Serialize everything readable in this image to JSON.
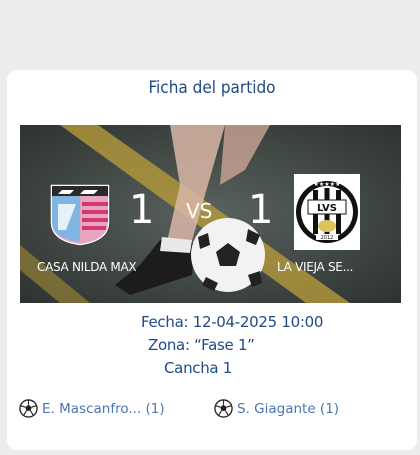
{
  "card": {
    "title": "Ficha del partido"
  },
  "match": {
    "home": {
      "name": "CASA NILDA MAX",
      "score": "1"
    },
    "away": {
      "name": "LA VIEJA SE...",
      "score": "1"
    },
    "vs_label": "VS",
    "home_crest_icon": "casa-nilda-max-crest-icon",
    "away_crest_icon": "lvs-crest-icon",
    "away_crest_text": "LVS",
    "away_crest_year": "2012"
  },
  "details": {
    "fecha": "Fecha: 12-04-2025 10:00",
    "zona": "Zona: “Fase 1”",
    "cancha": "Cancha 1"
  },
  "scorers": [
    {
      "name": "E. Mascanfro... (1)",
      "icon": "soccer-ball-icon"
    },
    {
      "name": "S. Giagante (1)",
      "icon": "soccer-ball-icon"
    }
  ],
  "colors": {
    "title": "#1f4a86",
    "scorer": "#4b74b8",
    "card": "#ffffff",
    "background": "#ececec"
  }
}
